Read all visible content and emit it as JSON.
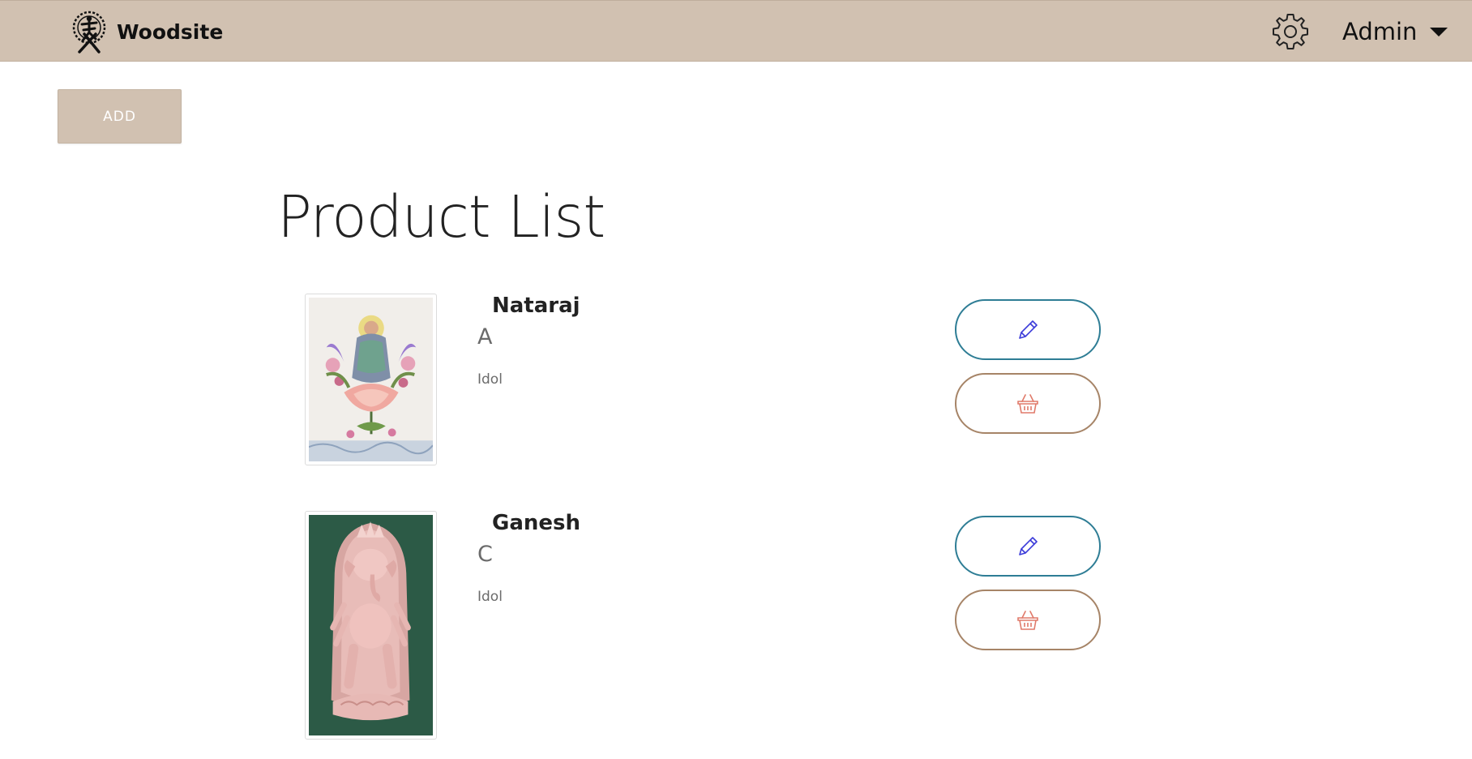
{
  "navbar": {
    "brand_name": "Woodsite",
    "logo_icon": "dancing-deity-emblem-icon",
    "settings_icon": "gear-icon",
    "user_name": "Admin",
    "user_menu_icon": "caret-down-icon"
  },
  "toolbar": {
    "add_label": "ADD"
  },
  "page": {
    "title": "Product List"
  },
  "products": [
    {
      "name": "Nataraj",
      "code": "A",
      "category": "Idol",
      "image": "colorful-painting-of-deity-on-lotus",
      "edit_icon": "pencil-icon",
      "delete_icon": "basket-icon"
    },
    {
      "name": "Ganesh",
      "code": "C",
      "category": "Idol",
      "image": "pink-carved-ganesh-statue-on-green-background",
      "edit_icon": "pencil-icon",
      "delete_icon": "basket-icon"
    }
  ],
  "colors": {
    "navbar_bg": "#d1c1b1",
    "edit_border": "#2e7d95",
    "edit_icon": "#3b3bd9",
    "delete_border": "#a68467",
    "delete_icon": "#e07a6a"
  }
}
